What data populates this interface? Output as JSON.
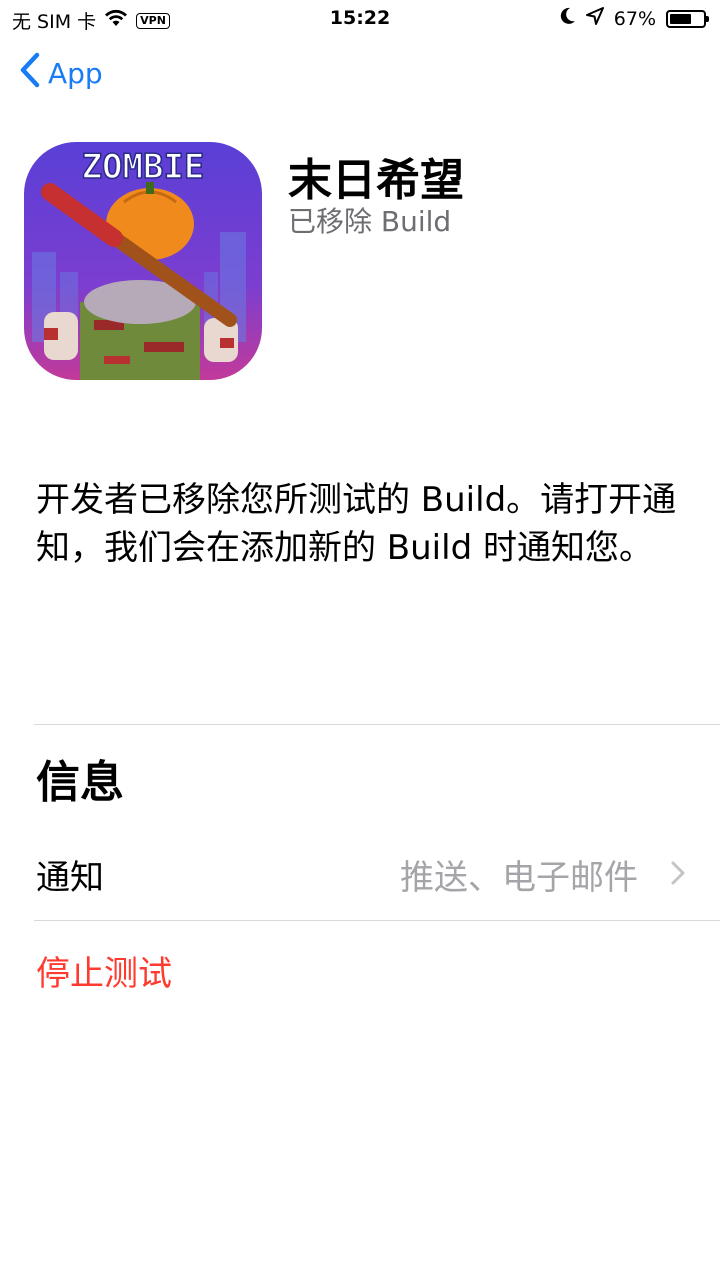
{
  "status_bar": {
    "carrier": "无 SIM 卡",
    "vpn": "VPN",
    "time": "15:22",
    "battery_percent": "67%",
    "battery_level": 0.67
  },
  "nav": {
    "back_label": "App"
  },
  "app": {
    "name": "末日希望",
    "status": "已移除 Build",
    "icon_text": "ZOMBIE"
  },
  "description": "开发者已移除您所测试的 Build。请打开通知，我们会在添加新的 Build 时通知您。",
  "info_section": {
    "title": "信息",
    "notification_label": "通知",
    "notification_value": "推送、电子邮件"
  },
  "actions": {
    "stop_testing": "停止测试"
  },
  "colors": {
    "accent": "#1a7cf5",
    "destructive": "#ff3b30",
    "secondary_text": "#a4a4a9"
  }
}
